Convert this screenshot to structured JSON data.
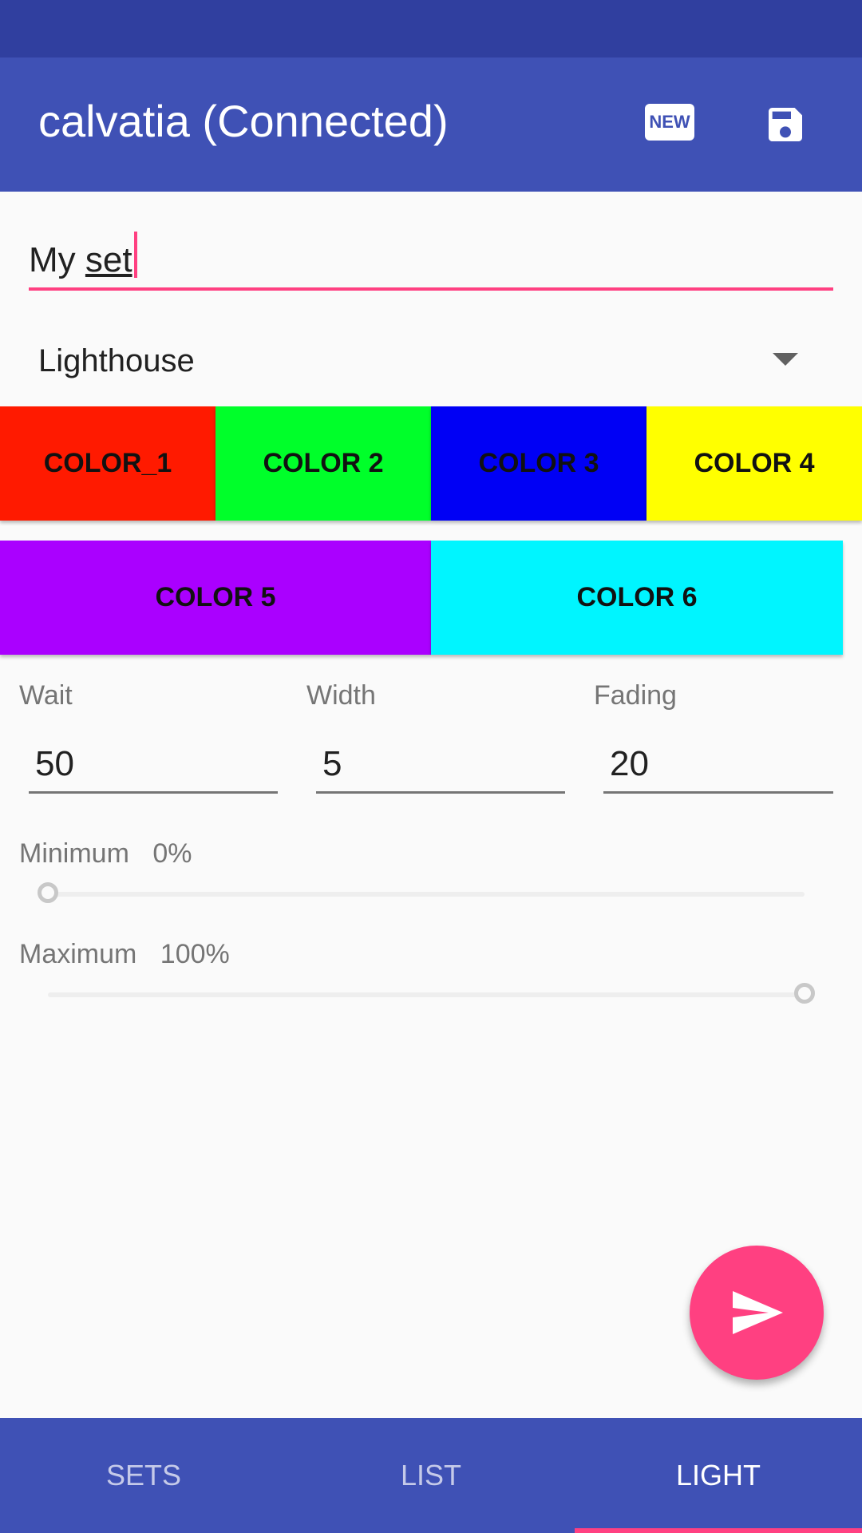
{
  "colors": {
    "primary": "#3f51b5",
    "primary_dark": "#303f9f",
    "accent": "#ff4081"
  },
  "app_bar": {
    "title": "calvatia (Connected)",
    "new_icon_text": "NEW",
    "new_icon": "new-icon",
    "save_icon": "save-icon"
  },
  "set_name": {
    "value_prefix": "My ",
    "value_word": "set"
  },
  "mode_spinner": {
    "selected": "Lighthouse"
  },
  "color_buttons": [
    {
      "label": "COLOR_1",
      "color": "#ff1a00"
    },
    {
      "label": "COLOR 2",
      "color": "#00ff2a"
    },
    {
      "label": "COLOR 3",
      "color": "#0000f5"
    },
    {
      "label": "COLOR 4",
      "color": "#ffff00"
    },
    {
      "label": "COLOR 5",
      "color": "#aa00ff"
    },
    {
      "label": "COLOR 6",
      "color": "#00f5ff"
    }
  ],
  "params": {
    "wait": {
      "label": "Wait",
      "value": "50"
    },
    "width": {
      "label": "Width",
      "value": "5"
    },
    "fading": {
      "label": "Fading",
      "value": "20"
    }
  },
  "minimum": {
    "label": "Minimum",
    "value_text": "0%",
    "level": 0
  },
  "maximum": {
    "label": "Maximum",
    "value_text": "100%",
    "level": 100
  },
  "fab_icon": "send-icon",
  "bottom_nav": {
    "tabs": [
      {
        "label": "SETS",
        "active": false
      },
      {
        "label": "LIST",
        "active": false
      },
      {
        "label": "LIGHT",
        "active": true
      }
    ]
  }
}
